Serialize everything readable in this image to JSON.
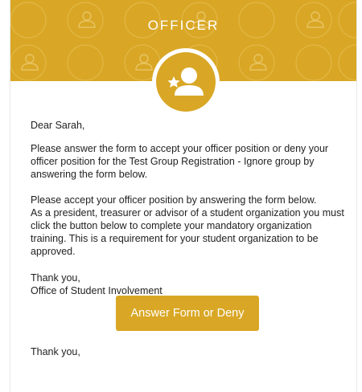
{
  "banner": {
    "title": "OFFICER",
    "color": "#d9a725",
    "icon": "officer-star-person-icon"
  },
  "email": {
    "greeting": "Dear Sarah,",
    "paragraph1": "Please answer the form to accept your officer position or deny your officer position for the Test Group Registration - Ignore group by answering the form below.",
    "paragraph2_line1": "Please accept your officer position by answering the form below.",
    "paragraph2_line2": "As a president, treasurer or advisor of a student organization you must click the button below to complete your mandatory organization training. This is a requirement for your student organization to be approved.",
    "thanks": "Thank you,",
    "signoff": "Office of Student Involvement",
    "button_label": "Answer Form or Deny",
    "closing": "Thank you,"
  }
}
